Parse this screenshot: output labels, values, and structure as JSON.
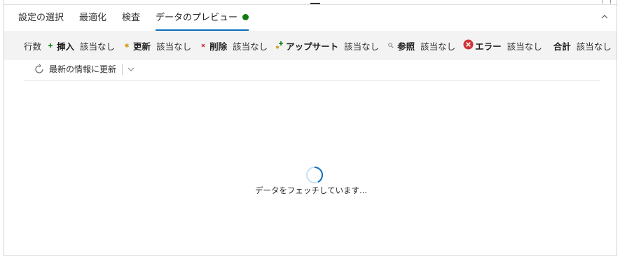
{
  "tabs": [
    {
      "label": "設定の選択"
    },
    {
      "label": "最適化"
    },
    {
      "label": "検査"
    },
    {
      "label": "データのプレビュー",
      "active": true
    }
  ],
  "stats": {
    "rows_label": "行数",
    "items": [
      {
        "icon": "plus-icon",
        "label": "挿入",
        "value": "該当なし",
        "color": "#107c10"
      },
      {
        "icon": "asterisk-icon",
        "label": "更新",
        "value": "該当なし",
        "color": "#d29200"
      },
      {
        "icon": "x-icon",
        "label": "削除",
        "value": "該当なし",
        "color": "#d13438"
      },
      {
        "icon": "upsert-icon",
        "label": "アップサート",
        "value": "該当なし",
        "color": "#107c10"
      },
      {
        "icon": "lookup-icon",
        "label": "参照",
        "value": "該当なし",
        "color": "#8a8886"
      },
      {
        "icon": "error-icon",
        "label": "エラー",
        "value": "該当なし",
        "color": "#d13438"
      },
      {
        "icon": "",
        "label": "合計",
        "value": "該当なし",
        "color": ""
      }
    ]
  },
  "toolbar": {
    "refresh_label": "最新の情報に更新"
  },
  "status": {
    "loading_text": "データをフェッチしています..."
  },
  "colors": {
    "accent": "#0f6cbd",
    "status_dot": "#107c10",
    "stats_bg": "#f3f3f3"
  }
}
